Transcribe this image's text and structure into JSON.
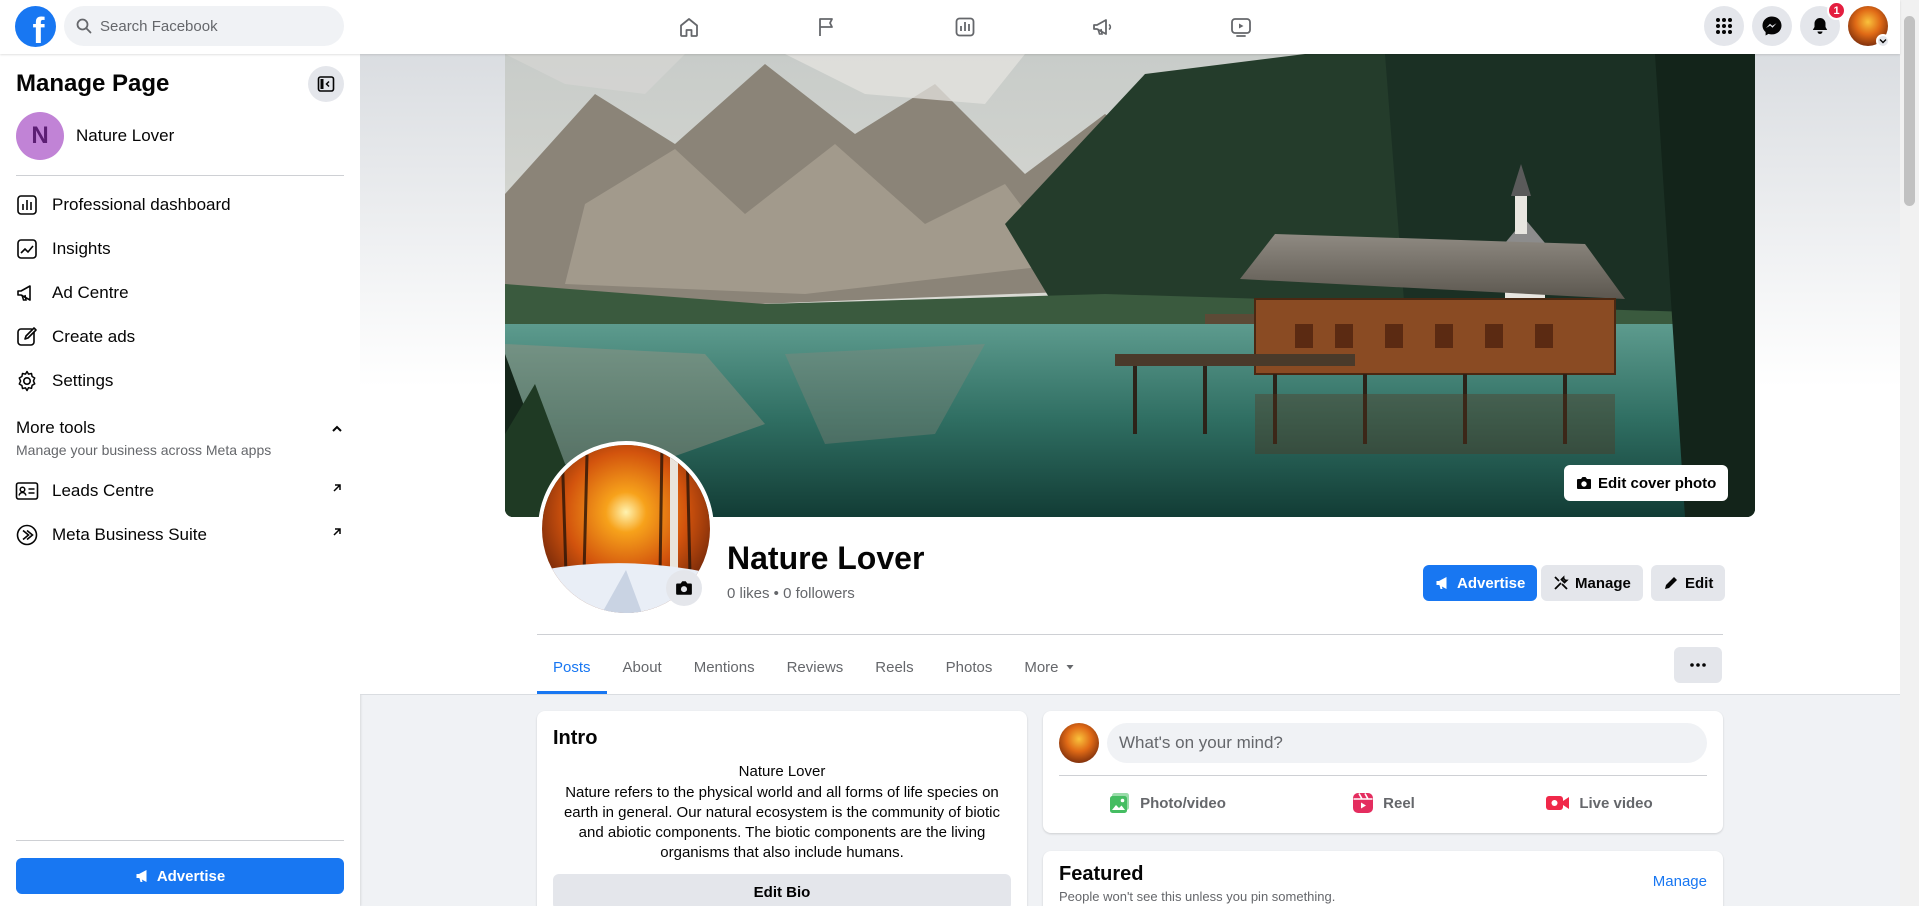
{
  "colors": {
    "brand": "#1877f2",
    "badge": "#e41e3f",
    "page_avatar": "#c183d6"
  },
  "topbar": {
    "logo": "f",
    "search_placeholder": "Search Facebook",
    "nav": [
      "home-icon",
      "flag-icon",
      "insights-icon",
      "megaphone-icon",
      "video-icon"
    ],
    "notification_count": "1"
  },
  "sidebar": {
    "title": "Manage Page",
    "page_initial": "N",
    "page_name": "Nature Lover",
    "items": [
      {
        "label": "Professional dashboard",
        "icon": "dashboard-icon"
      },
      {
        "label": "Insights",
        "icon": "insights-icon"
      },
      {
        "label": "Ad Centre",
        "icon": "megaphone-icon"
      },
      {
        "label": "Create ads",
        "icon": "pencil-icon"
      },
      {
        "label": "Settings",
        "icon": "gear-icon"
      }
    ],
    "more_tools": {
      "heading": "More tools",
      "subtitle": "Manage your business across Meta apps"
    },
    "tools": [
      {
        "label": "Leads Centre",
        "icon": "contact-card-icon"
      },
      {
        "label": "Meta Business Suite",
        "icon": "meta-suite-icon"
      }
    ],
    "advertise_label": "Advertise"
  },
  "page": {
    "name": "Nature Lover",
    "stats": "0 likes • 0 followers",
    "edit_cover_label": "Edit cover photo",
    "actions": {
      "advertise": "Advertise",
      "manage": "Manage",
      "edit": "Edit"
    },
    "tabs": [
      "Posts",
      "About",
      "Mentions",
      "Reviews",
      "Reels",
      "Photos",
      "More"
    ],
    "active_tab": "Posts"
  },
  "intro": {
    "title": "Intro",
    "bio_name": "Nature Lover",
    "bio": "Nature refers to the physical world and all forms of life species on earth in general. Our natural ecosystem is the community of biotic and abiotic components. The biotic components are the living organisms that also include humans.",
    "edit_bio_label": "Edit Bio"
  },
  "composer": {
    "placeholder": "What's on your mind?",
    "options": [
      "Photo/video",
      "Reel",
      "Live video"
    ]
  },
  "featured": {
    "title": "Featured",
    "subtitle": "People won't see this unless you pin something.",
    "manage_label": "Manage"
  }
}
